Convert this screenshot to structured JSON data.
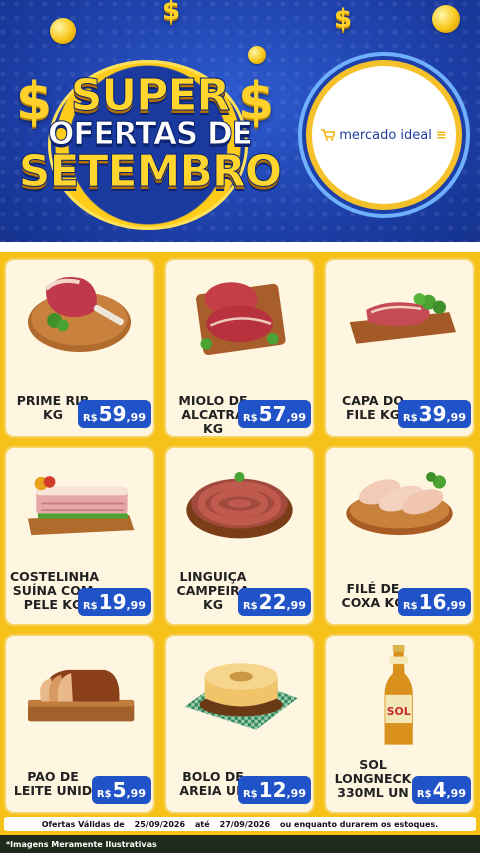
{
  "header": {
    "title_line1": "SUPER",
    "title_line2": "OFERTAS DE",
    "title_line3": "SETEMBRO",
    "store_name": "mercado ideal",
    "currency_symbol": "$"
  },
  "currency": "R$",
  "products": [
    {
      "name": "PRIME RIB\nKG",
      "price_int": "59",
      "price_dec": ",99",
      "image": "prime-rib-meat"
    },
    {
      "name": "MIOLO DE\nALCATRA KG",
      "price_int": "57",
      "price_dec": ",99",
      "image": "alcatra-meat"
    },
    {
      "name": "CAPA DO\nFILE KG",
      "price_int": "39",
      "price_dec": ",99",
      "image": "capa-file-meat"
    },
    {
      "name": "COSTELINHA\nSUÍNA COM\nPELE KG",
      "price_int": "19",
      "price_dec": ",99",
      "image": "pork-ribs"
    },
    {
      "name": "LINGUIÇA\nCAMPEIRA\nKG",
      "price_int": "22",
      "price_dec": ",99",
      "image": "sausage-coil"
    },
    {
      "name": "FILÉ DE\nCOXA KG",
      "price_int": "16",
      "price_dec": ",99",
      "image": "chicken-fillet"
    },
    {
      "name": "PAO DE\nLEITE UNID",
      "price_int": "5",
      "price_dec": ",99",
      "image": "milk-bread"
    },
    {
      "name": "BOLO DE\nAREIA UN",
      "price_int": "12",
      "price_dec": ",99",
      "image": "sand-cake"
    },
    {
      "name": "SOL\nLONGNECK\n330ML UN",
      "price_int": "4",
      "price_dec": ",99",
      "image": "sol-beer-bottle"
    }
  ],
  "footer": {
    "validity_label": "Ofertas Válidas de",
    "date_from": "25/09/2026",
    "until": "até",
    "date_to": "27/09/2026",
    "validity_suffix": "ou enquanto durarem os estoques.",
    "disclaimer": "*Imagens Meramente Ilustrativas"
  },
  "colors": {
    "header_blue": "#1d3fa8",
    "background_yellow": "#f6c21a",
    "price_blue": "#1f53c7",
    "card_cream": "#fff6e1"
  }
}
